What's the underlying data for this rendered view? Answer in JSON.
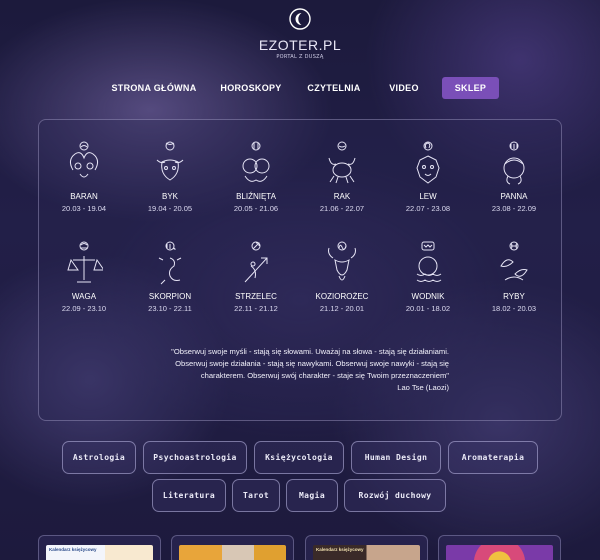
{
  "logo": {
    "text": "EZOTER.PL",
    "subtitle": "PORTAL Z DUSZĄ",
    "icon": "crescent-moon-icon"
  },
  "nav": {
    "items": [
      {
        "label": "STRONA GŁÓWNA"
      },
      {
        "label": "HOROSKOPY"
      },
      {
        "label": "CZYTELNIA"
      },
      {
        "label": "VIDEO"
      },
      {
        "label": "SKLEP",
        "active": true
      }
    ],
    "active_color": "#7a4fb8"
  },
  "zodiac": {
    "signs": [
      {
        "name": "BARAN",
        "dates": "20.03 - 19.04",
        "icon": "aries-icon"
      },
      {
        "name": "BYK",
        "dates": "19.04 - 20.05",
        "icon": "taurus-icon"
      },
      {
        "name": "BLIŹNIĘTA",
        "dates": "20.05 - 21.06",
        "icon": "gemini-icon"
      },
      {
        "name": "RAK",
        "dates": "21.06 - 22.07",
        "icon": "cancer-icon"
      },
      {
        "name": "LEW",
        "dates": "22.07 - 23.08",
        "icon": "leo-icon"
      },
      {
        "name": "PANNA",
        "dates": "23.08 - 22.09",
        "icon": "virgo-icon"
      },
      {
        "name": "WAGA",
        "dates": "22.09 - 23.10",
        "icon": "libra-icon"
      },
      {
        "name": "SKORPION",
        "dates": "23.10 - 22.11",
        "icon": "scorpio-icon"
      },
      {
        "name": "STRZELEC",
        "dates": "22.11 - 21.12",
        "icon": "sagittarius-icon"
      },
      {
        "name": "KOZIOROŻEC",
        "dates": "21.12 - 20.01",
        "icon": "capricorn-icon"
      },
      {
        "name": "WODNIK",
        "dates": "20.01 - 18.02",
        "icon": "aquarius-icon"
      },
      {
        "name": "RYBY",
        "dates": "18.02 - 20.03",
        "icon": "pisces-icon"
      }
    ],
    "quote": {
      "lines": [
        "\"Obserwuj swoje myśli - stają się słowami. Uważaj na słowa - stają się działaniami.",
        "Obserwuj swoje działania - stają się nawykami. Obserwuj swoje nawyki - stają się",
        "charakterem. Obserwuj swój charakter - staje się Twoim przeznaczeniem\""
      ],
      "author": "Lao Tse (Laozi)"
    }
  },
  "categories": [
    "Astrologia",
    "Psychoastrologia",
    "Księżycologia",
    "Human Design",
    "Aromaterapia",
    "Literatura",
    "Tarot",
    "Magia",
    "Rozwój duchowy"
  ],
  "cards": [
    {
      "thumb_text": "Kalendarz księżycowy"
    },
    {
      "thumb_text": ""
    },
    {
      "thumb_text": "Kalendarz księżycowy"
    },
    {
      "thumb_text": ""
    }
  ]
}
